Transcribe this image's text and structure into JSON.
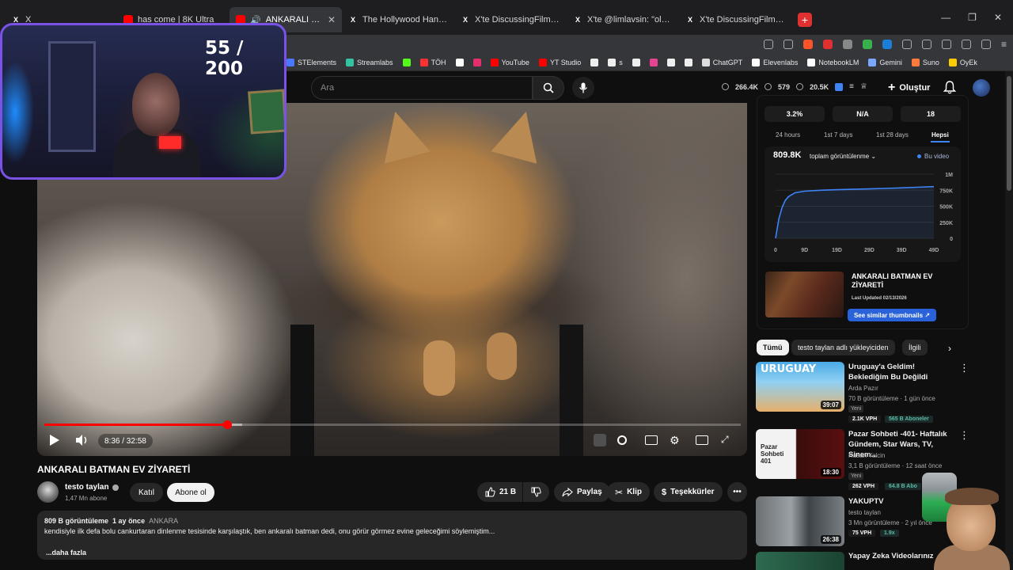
{
  "browser": {
    "tabs": [
      {
        "label": "X",
        "kind": "x",
        "active": false
      },
      {
        "label": "has come | 8K Ultra",
        "kind": "yt",
        "active": false
      },
      {
        "label": "ANKARALI BATMAN EV",
        "kind": "yt",
        "active": true
      },
      {
        "label": "The Hollywood Handle (@Holl",
        "kind": "x",
        "active": false
      },
      {
        "label": "X'te DiscussingFilm: \"Steven Sp",
        "kind": "x",
        "active": false
      },
      {
        "label": "X'te @limlavsin: \"ole gunnar so",
        "kind": "x",
        "active": false
      },
      {
        "label": "X'te DiscussingFilm: \"Steven Sp",
        "kind": "x",
        "active": false
      }
    ],
    "new_tab": "+"
  },
  "bookmarks": [
    {
      "label": "STElements",
      "color": "#4a78ff"
    },
    {
      "label": "Streamlabs",
      "color": "#31c3a2"
    },
    {
      "label": "",
      "color": "#53fc18"
    },
    {
      "label": "TÖH",
      "color": "#ff3030"
    },
    {
      "label": "",
      "color": "#ffffff"
    },
    {
      "label": "",
      "color": "#e1306c"
    },
    {
      "label": "YouTube",
      "color": "#ff0000"
    },
    {
      "label": "YT Studio",
      "color": "#ff0000"
    },
    {
      "label": "",
      "color": "#eeeeee"
    },
    {
      "label": "s",
      "color": "#eeeeee"
    },
    {
      "label": "",
      "color": "#eeeeee"
    },
    {
      "label": "",
      "color": "#e84393"
    },
    {
      "label": "",
      "color": "#eeeeee"
    },
    {
      "label": "",
      "color": "#eeeeee"
    },
    {
      "label": "ChatGPT",
      "color": "#dddddd"
    },
    {
      "label": "Elevenlabs",
      "color": "#ffffff"
    },
    {
      "label": "NotebookLM",
      "color": "#ffffff"
    },
    {
      "label": "Gemini",
      "color": "#7aa7ff"
    },
    {
      "label": "Suno",
      "color": "#ff7a3d"
    },
    {
      "label": "OyEk",
      "color": "#ffcc00"
    }
  ],
  "header": {
    "search_placeholder": "Ara",
    "stats": [
      "266.4K",
      "579",
      "20.5K"
    ],
    "create_label": "Oluştur"
  },
  "player": {
    "time": "8:36 / 32:58",
    "progress": 0.262,
    "buffered": 0.284
  },
  "video": {
    "title": "ANKARALI BATMAN EV ZİYARETİ",
    "channel": "testo taylan",
    "subscribers": "1,47 Mn abone",
    "join_label": "Katıl",
    "subscribe_label": "Abone ol",
    "likes": "21 B",
    "share_label": "Paylaş",
    "clip_label": "Klip",
    "thanks_label": "Teşekkürler",
    "views": "809 B görüntüleme",
    "age": "1 ay önce",
    "tag": "ANKARA",
    "description": "kendisiyle ilk defa bolu cankurtaran dinlenme tesisinde karşılaştık, ben ankaralı batman dedi, onu görür görmez evine geleceğimi söylemiştim...",
    "more_label": "...daha fazla"
  },
  "analytics": {
    "top_cells": [
      "3.2%",
      "N/A",
      "18"
    ],
    "tabs": [
      "24 hours",
      "1st 7 days",
      "1st 28 days",
      "Hepsi"
    ],
    "selected_tab": "Hepsi",
    "big_value": "809.8K",
    "metric_label": "toplam görüntülenme",
    "legend_label": "Bu video",
    "thumb_title": "ANKARALI BATMAN EV ZİYARETİ",
    "thumb_updated": "Last Updated 02/13/2026",
    "similar_label": "See similar thumbnails"
  },
  "chart_data": {
    "type": "line",
    "x_ticks": [
      "0",
      "9D",
      "19D",
      "29D",
      "39D",
      "49D"
    ],
    "y_ticks": [
      "0",
      "250K",
      "500K",
      "750K",
      "1M"
    ],
    "x": [
      0,
      1,
      2,
      3,
      4,
      6,
      9,
      14,
      19,
      24,
      29,
      34,
      39,
      44,
      49
    ],
    "y": [
      0,
      300000,
      480000,
      590000,
      650000,
      710000,
      735000,
      750000,
      758000,
      764000,
      770000,
      778000,
      786000,
      796000,
      806000
    ],
    "ylim": [
      0,
      1000000
    ],
    "xlim": [
      0,
      49
    ],
    "series_name": "Bu video",
    "color": "#3e84f7"
  },
  "chips": [
    "Tümü",
    "testo taylan adlı yükleyiciden",
    "İlgili"
  ],
  "recommendations": [
    {
      "title": "Uruguay'a Geldim! Beklediğim Bu Değildi",
      "channel": "Arda Pazır",
      "meta": "70 B görüntüleme · 1 gün önce",
      "new": "Yeni",
      "duration": "39:07",
      "vph": "2.1K VPH",
      "subs": "565 B Aboneler",
      "thumb_text": "URUGUAY"
    },
    {
      "title": "Pazar Sohbeti -401- Haftalık Gündem, Star Wars, TV, Sinem...",
      "channel": "Hasan Yalcin",
      "meta": "3,1 B görüntüleme · 12 saat önce",
      "new": "Yeni",
      "duration": "18:30",
      "vph": "262 VPH",
      "subs": "64.8 B Abo",
      "thumb_text": "Pazar Sohbeti 401"
    },
    {
      "title": "YAKUPTV",
      "channel": "testo taylan",
      "meta": "3 Mn görüntüleme · 2 yıl önce",
      "new": "",
      "duration": "26:38",
      "vph": "75 VPH",
      "subs": "1.9x",
      "thumb_text": ""
    },
    {
      "title": "Yapay Zeka Videolarınız",
      "channel": "",
      "meta": "",
      "new": "",
      "duration": "",
      "vph": "",
      "subs": "",
      "thumb_text": ""
    }
  ],
  "webcam": {
    "counter": "55 / 200"
  }
}
